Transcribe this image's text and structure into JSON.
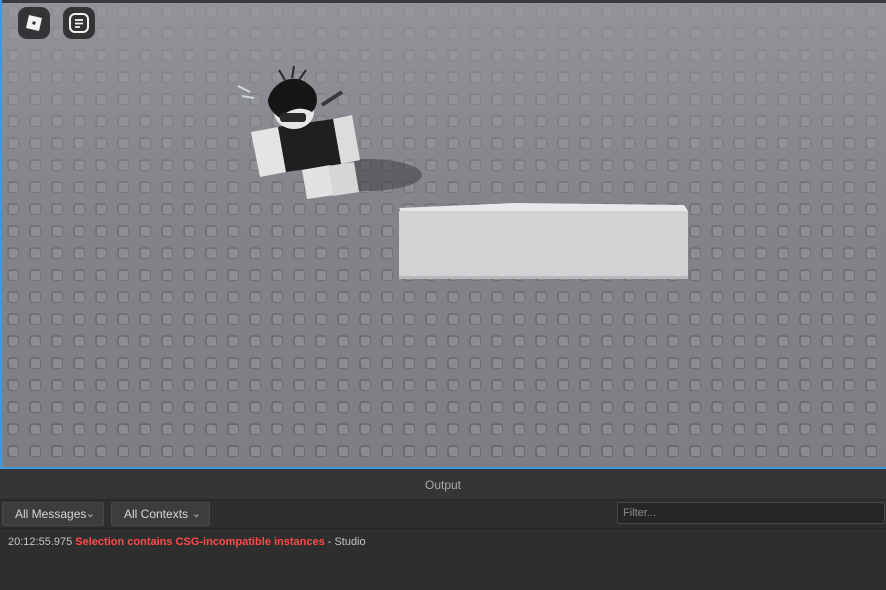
{
  "viewport": {
    "roblox_button_icon": "roblox-logo-icon",
    "chat_button_icon": "chat-menu-icon",
    "ground_color": "#7d7e83",
    "part_color": "#d2d2d4"
  },
  "output": {
    "title": "Output",
    "messages_filter": "All Messages",
    "contexts_filter": "All Contexts",
    "filter_placeholder": "Filter...",
    "log": [
      {
        "timestamp": "20:12:55.975",
        "message": "Selection contains CSG-incompatible instances",
        "separator": " - ",
        "source": "Studio",
        "color": "#ff4a4a"
      }
    ]
  }
}
